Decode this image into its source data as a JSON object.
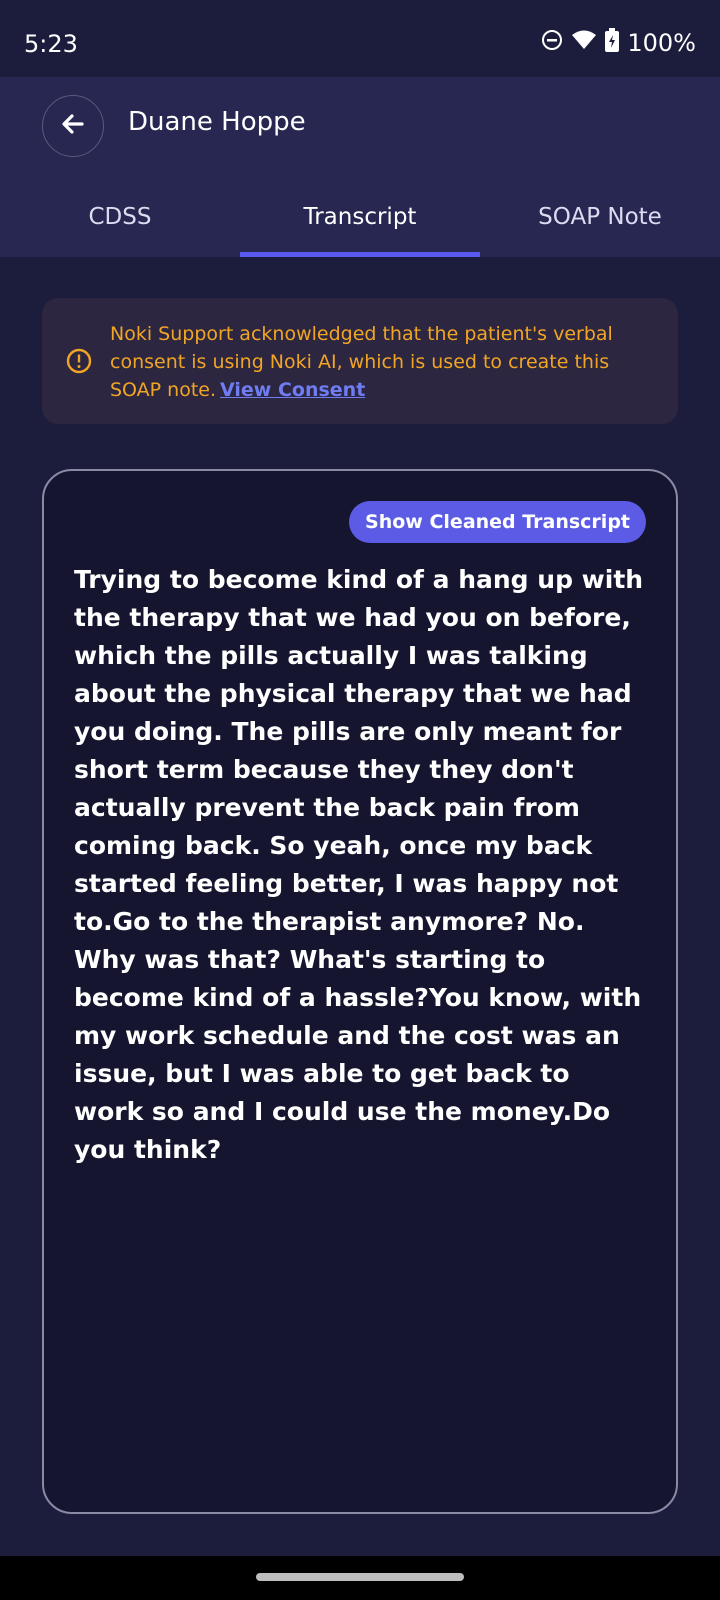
{
  "status": {
    "time": "5:23",
    "battery": "100%",
    "icons": [
      "do-not-disturb-icon",
      "wifi-icon",
      "battery-charging-icon"
    ]
  },
  "header": {
    "patient_name": "Duane Hoppe",
    "back_icon": "arrow-left-icon"
  },
  "tabs": [
    {
      "label": "CDSS",
      "active": false
    },
    {
      "label": "Transcript",
      "active": true
    },
    {
      "label": "SOAP Note",
      "active": false
    }
  ],
  "consent": {
    "text": "Noki Support acknowledged that the patient's verbal consent is using Noki AI, which is used to create this SOAP note.",
    "link": "View Consent",
    "icon": "info-circle-icon"
  },
  "transcript": {
    "button_label": "Show Cleaned Transcript",
    "text": "Trying to become kind of a hang up with the therapy that we had you on before, which the pills actually I was talking about the physical therapy that we had you doing. The pills are only meant for short term because they they don't actually prevent the back pain from coming back. So yeah, once my back started feeling better, I was happy not to.Go to the therapist anymore? No. Why was that? What's starting to become kind of a hassle?You know, with my work schedule and the cost was an issue, but I was able to get back to work so and I could use the money.Do you think?"
  },
  "colors": {
    "background": "#1c1c3c",
    "header": "#272752",
    "accent": "#5b5be6",
    "warning": "#f1a525",
    "link": "#6f7cf2"
  }
}
